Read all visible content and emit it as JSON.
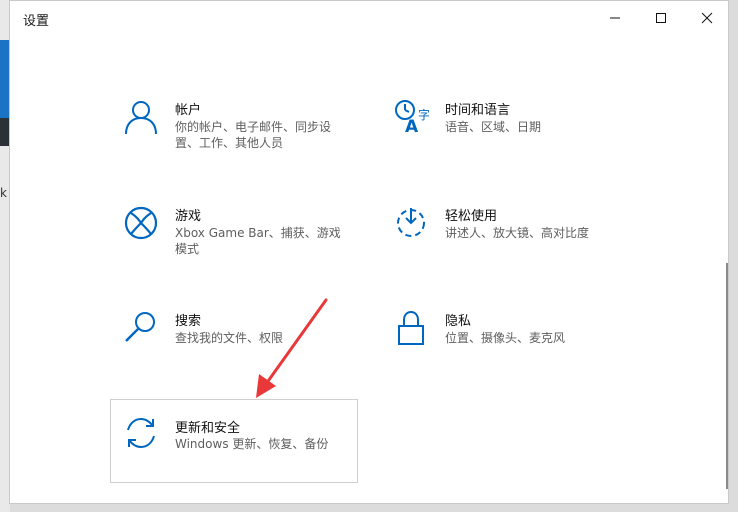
{
  "window": {
    "title": "设置"
  },
  "controls": {
    "minimize": "minimize-icon",
    "maximize": "maximize-icon",
    "close": "close-icon"
  },
  "colors": {
    "accent": "#0067c0",
    "arrow": "#e8383a"
  },
  "tiles": [
    {
      "name": "帐户",
      "desc": [
        "你的帐户、电子邮件、同步设",
        "置、工作、其他人员"
      ],
      "icon": "person-icon"
    },
    {
      "name": "时间和语言",
      "desc": [
        "语音、区域、日期"
      ],
      "icon": "time-language-icon"
    },
    {
      "name": "游戏",
      "desc": [
        "Xbox Game Bar、捕获、游戏",
        "模式"
      ],
      "icon": "xbox-icon"
    },
    {
      "name": "轻松使用",
      "desc": [
        "讲述人、放大镜、高对比度"
      ],
      "icon": "ease-of-access-icon"
    },
    {
      "name": "搜索",
      "desc": [
        "查找我的文件、权限"
      ],
      "icon": "search-icon"
    },
    {
      "name": "隐私",
      "desc": [
        "位置、摄像头、麦克风"
      ],
      "icon": "lock-icon"
    },
    {
      "name": "更新和安全",
      "desc": [
        "Windows 更新、恢复、备份"
      ],
      "icon": "update-icon"
    }
  ],
  "background": {
    "edge_char": "k"
  }
}
